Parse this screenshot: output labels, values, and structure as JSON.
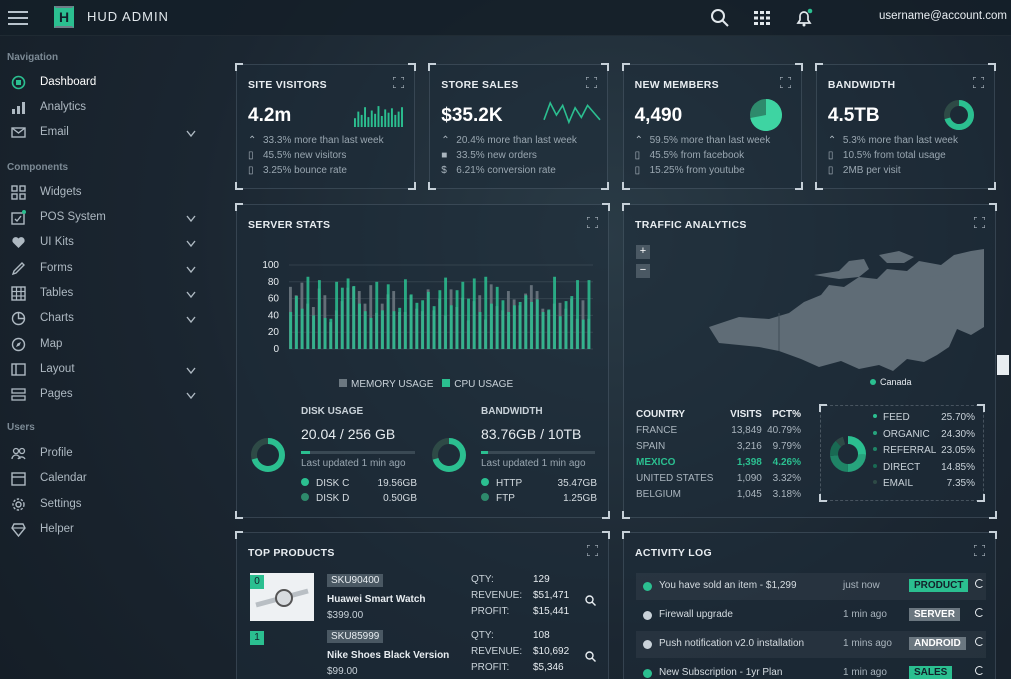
{
  "app": {
    "title": "HUD ADMIN",
    "logo_letter": "H",
    "user": "username@account.com"
  },
  "colors": {
    "accent": "#2bbf90",
    "bg": "#1b2631",
    "panel": "#1e2c38"
  },
  "sidebar": {
    "sections": [
      {
        "heading": "Navigation",
        "items": [
          {
            "label": "Dashboard",
            "icon": "dashboard-icon",
            "active": true
          },
          {
            "label": "Analytics",
            "icon": "bar-chart-icon"
          },
          {
            "label": "Email",
            "icon": "envelope-icon",
            "caret": true
          }
        ]
      },
      {
        "heading": "Components",
        "items": [
          {
            "label": "Widgets",
            "icon": "widgets-icon"
          },
          {
            "label": "POS System",
            "icon": "pos-icon",
            "caret": true
          },
          {
            "label": "UI Kits",
            "icon": "heart-icon",
            "caret": true
          },
          {
            "label": "Forms",
            "icon": "pen-icon",
            "caret": true
          },
          {
            "label": "Tables",
            "icon": "table-icon",
            "caret": true
          },
          {
            "label": "Charts",
            "icon": "pie-chart-icon",
            "caret": true
          },
          {
            "label": "Map",
            "icon": "compass-icon"
          },
          {
            "label": "Layout",
            "icon": "layout-icon",
            "caret": true
          },
          {
            "label": "Pages",
            "icon": "pages-icon",
            "caret": true
          }
        ]
      },
      {
        "heading": "Users",
        "items": [
          {
            "label": "Profile",
            "icon": "users-icon"
          },
          {
            "label": "Calendar",
            "icon": "calendar-icon"
          },
          {
            "label": "Settings",
            "icon": "gear-icon"
          },
          {
            "label": "Helper",
            "icon": "diamond-icon"
          }
        ]
      }
    ]
  },
  "stats": [
    {
      "title": "SITE VISITORS",
      "value": "4.2m",
      "lines": [
        "33.3% more than last week",
        "45.5% new visitors",
        "3.25% bounce rate"
      ],
      "graphic": "mini-bars",
      "mini_bars": [
        40,
        70,
        55,
        90,
        45,
        75,
        60,
        95,
        50,
        80,
        65,
        85,
        55,
        70,
        90
      ]
    },
    {
      "title": "STORE SALES",
      "value": "$35.2K",
      "lines": [
        "20.4% more than last week",
        "33.5% new orders",
        "6.21% conversion rate"
      ],
      "graphic": "sparkline",
      "sparkline": [
        3,
        10,
        5,
        9,
        2,
        8,
        4,
        9,
        6,
        3
      ]
    },
    {
      "title": "NEW MEMBERS",
      "value": "4,490",
      "lines": [
        "59.5% more than last week",
        "45.5% from facebook",
        "15.25% from youtube"
      ],
      "graphic": "pie",
      "pie_pct": 0.72
    },
    {
      "title": "BANDWIDTH",
      "value": "4.5TB",
      "lines": [
        "5.3% more than last week",
        "10.5% from total usage",
        "2MB per visit"
      ],
      "graphic": "donut",
      "donut_pct": 0.7
    }
  ],
  "server": {
    "title": "SERVER STATS",
    "legend": [
      "MEMORY USAGE",
      "CPU USAGE"
    ],
    "disk": {
      "title": "DISK USAGE",
      "value": "20.04 / 256 GB",
      "updated": "Last updated 1 min ago",
      "progress": 0.08,
      "rows": [
        {
          "label": "DISK C",
          "value": "19.56GB"
        },
        {
          "label": "DISK D",
          "value": "0.50GB"
        }
      ]
    },
    "bandwidth": {
      "title": "BANDWIDTH",
      "value": "83.76GB / 10TB",
      "updated": "Last updated 1 min ago",
      "progress": 0.06,
      "rows": [
        {
          "label": "HTTP",
          "value": "35.47GB"
        },
        {
          "label": "FTP",
          "value": "1.25GB"
        }
      ]
    }
  },
  "chart_data": {
    "type": "bar",
    "title": "SERVER STATS",
    "series": [
      {
        "name": "MEMORY USAGE",
        "values": [
          74,
          64,
          79,
          54,
          50,
          72,
          64,
          32,
          46,
          57,
          73,
          74,
          69,
          54,
          76,
          43,
          54,
          65,
          69,
          44,
          44,
          64,
          48,
          45,
          71,
          46,
          60,
          40,
          71,
          50,
          61,
          34,
          57,
          64,
          35,
          77,
          51,
          46,
          69,
          59,
          52,
          66,
          76,
          69,
          48,
          46,
          54,
          55,
          48,
          60,
          36,
          58,
          36
        ]
      },
      {
        "name": "CPU USAGE",
        "values": [
          44,
          63,
          48,
          86,
          40,
          82,
          37,
          36,
          80,
          73,
          84,
          75,
          54,
          45,
          37,
          80,
          46,
          77,
          45,
          49,
          83,
          65,
          55,
          58,
          68,
          51,
          70,
          85,
          52,
          70,
          80,
          60,
          84,
          44,
          86,
          54,
          74,
          58,
          44,
          52,
          56,
          64,
          56,
          59,
          44,
          47,
          86,
          39,
          57,
          63,
          82,
          35,
          82
        ]
      }
    ],
    "ylim": [
      0,
      100
    ],
    "yticks": [
      0,
      20,
      40,
      60,
      80,
      100
    ],
    "grid": true,
    "legend": "bottom"
  },
  "traffic": {
    "title": "TRAFFIC ANALYTICS",
    "map_label": "Canada",
    "zoom_in": "+",
    "zoom_out": "−",
    "headers": [
      "COUNTRY",
      "VISITS",
      "PCT%"
    ],
    "rows": [
      {
        "country": "FRANCE",
        "visits": "13,849",
        "pct": "40.79%"
      },
      {
        "country": "SPAIN",
        "visits": "3,216",
        "pct": "9.79%"
      },
      {
        "country": "MEXICO",
        "visits": "1,398",
        "pct": "4.26%",
        "highlight": true
      },
      {
        "country": "UNITED STATES",
        "visits": "1,090",
        "pct": "3.32%"
      },
      {
        "country": "BELGIUM",
        "visits": "1,045",
        "pct": "3.18%"
      }
    ],
    "sources": [
      {
        "label": "FEED",
        "pct": "25.70%",
        "color": "#2bbf90",
        "share": 0.257
      },
      {
        "label": "ORGANIC",
        "pct": "24.30%",
        "color": "#27a47d",
        "share": 0.243
      },
      {
        "label": "REFERRAL",
        "pct": "23.05%",
        "color": "#1f8466",
        "share": 0.2305
      },
      {
        "label": "DIRECT",
        "pct": "14.85%",
        "color": "#196a53",
        "share": 0.1485
      },
      {
        "label": "EMAIL",
        "pct": "7.35%",
        "color": "#2e4a46",
        "share": 0.0735
      }
    ]
  },
  "products": {
    "title": "TOP PRODUCTS",
    "labels": {
      "qty": "QTY:",
      "revenue": "REVENUE:",
      "profit": "PROFIT:"
    },
    "items": [
      {
        "rank": "0",
        "sku": "SKU90400",
        "name": "Huawei Smart Watch",
        "price": "$399.00",
        "qty": "129",
        "revenue": "$51,471",
        "profit": "$15,441"
      },
      {
        "rank": "1",
        "sku": "SKU85999",
        "name": "Nike Shoes Black Version",
        "price": "$99.00",
        "qty": "108",
        "revenue": "$10,692",
        "profit": "$5,346"
      }
    ]
  },
  "activity": {
    "title": "ACTIVITY LOG",
    "items": [
      {
        "text": "You have sold an item - $1,299",
        "time": "just now",
        "tag": "PRODUCT",
        "tag_color": "#2bbf90",
        "dot": "#2bbf90"
      },
      {
        "text": "Firewall upgrade",
        "time": "1 min ago",
        "tag": "SERVER",
        "tag_color": "#6b7780",
        "dot": "#c9d2d9"
      },
      {
        "text": "Push notification v2.0 installation",
        "time": "1 mins ago",
        "tag": "ANDROID",
        "tag_color": "#6b7780",
        "dot": "#c9d2d9"
      },
      {
        "text": "New Subscription - 1yr Plan",
        "time": "1 min ago",
        "tag": "SALES",
        "tag_color": "#2bbf90",
        "dot": "#2bbf90"
      }
    ]
  }
}
